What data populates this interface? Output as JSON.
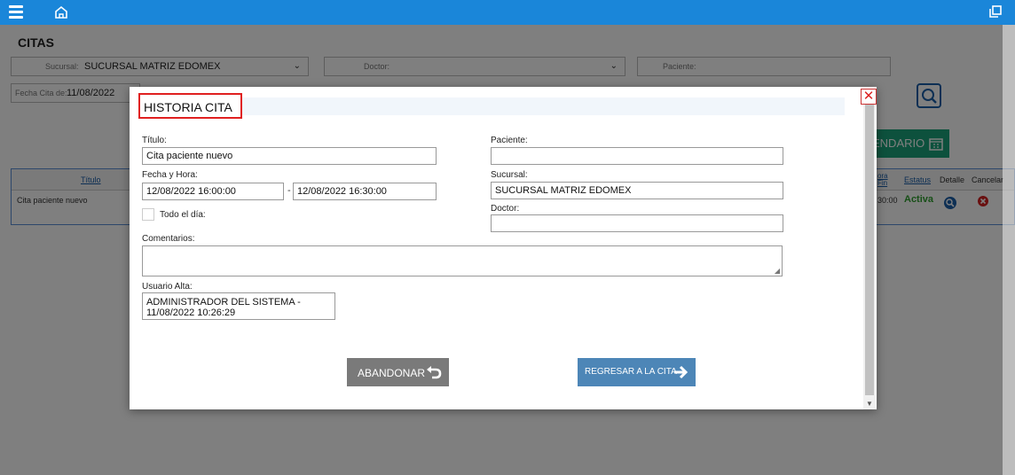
{
  "page": {
    "title": "CITAS"
  },
  "filters": {
    "sucursal_label": "Sucursal:",
    "sucursal_value": "SUCURSAL MATRIZ EDOMEX",
    "doctor_label": "Doctor:",
    "doctor_value": "",
    "paciente_label": "Paciente:",
    "paciente_value": "",
    "fecha_label": "Fecha Cita de:",
    "fecha_value": "11/08/2022"
  },
  "calendar_button": {
    "label": "ENDARIO"
  },
  "grid": {
    "headers": {
      "titulo": "Título",
      "hora_fin": "ora Fin",
      "estatus": "Estatus",
      "detalle": "Detalle",
      "cancelar": "Cancelar"
    },
    "rows": [
      {
        "titulo": "Cita paciente nuevo",
        "hora_fin": "30:00",
        "estatus": "Activa"
      }
    ]
  },
  "modal": {
    "title": "HISTORIA CITA",
    "titulo_label": "Título:",
    "titulo_value": "Cita paciente nuevo",
    "fecha_hora_label": "Fecha y Hora:",
    "fecha_inicio": "12/08/2022 16:00:00",
    "fecha_fin": "12/08/2022 16:30:00",
    "todo_dia_label": "Todo el día:",
    "paciente_label": "Paciente:",
    "paciente_value": "",
    "sucursal_label": "Sucursal:",
    "sucursal_value": "SUCURSAL MATRIZ EDOMEX",
    "doctor_label": "Doctor:",
    "doctor_value": "",
    "comentarios_label": "Comentarios:",
    "comentarios_value": "",
    "usuario_alta_label": "Usuario Alta:",
    "usuario_alta_value": "ADMINISTRADOR DEL SISTEMA - 11/08/2022 10:26:29",
    "abandonar_label": "ABANDONAR",
    "regresar_label": "REGRESAR A LA CITA"
  },
  "colors": {
    "topbar": "#1a86d9",
    "title_highlight": "#e02020",
    "status_active": "#2e9e2e",
    "btn_gray": "#7a7a7a",
    "btn_blue": "#4d86b7",
    "calendar_btn": "#1aa37a"
  },
  "icons": {
    "menu": "hamburger-icon",
    "home": "home-icon",
    "window": "restore-window-icon",
    "search": "search-icon",
    "calendar": "calendar-icon",
    "close": "close-icon",
    "back": "undo-arrow-icon",
    "forward": "arrow-right-icon"
  }
}
